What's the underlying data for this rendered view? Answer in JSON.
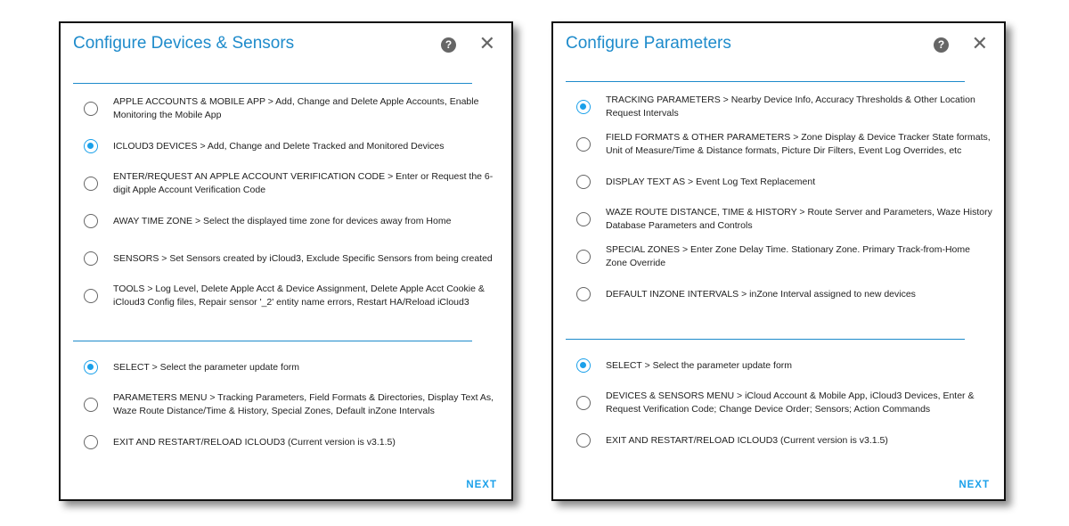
{
  "dialogs": [
    {
      "title": "Configure Devices & Sensors",
      "group1": [
        {
          "label": "APPLE ACCOUNTS & MOBILE APP > Add, Change and Delete Apple Accounts, Enable Monitoring the Mobile App",
          "selected": false
        },
        {
          "label": "ICLOUD3 DEVICES > Add, Change and Delete Tracked and Monitored Devices",
          "selected": true
        },
        {
          "label": "ENTER/REQUEST AN APPLE ACCOUNT VERIFICATION CODE > Enter or Request the 6-digit Apple Account Verification Code",
          "selected": false
        },
        {
          "label": "AWAY TIME ZONE > Select the displayed time zone for devices away from Home",
          "selected": false
        },
        {
          "label": "SENSORS > Set Sensors created by iCloud3, Exclude Specific Sensors from being created",
          "selected": false
        },
        {
          "label": "TOOLS > Log Level, Delete Apple Acct & Device Assignment, Delete Apple Acct Cookie & iCloud3 Config files, Repair sensor '_2' entity name errors, Restart HA/Reload iCloud3",
          "selected": false
        }
      ],
      "group2": [
        {
          "label": "SELECT > Select the parameter update form",
          "selected": true
        },
        {
          "label": "PARAMETERS MENU > Tracking Parameters, Field Formats & Directories, Display Text As, Waze Route Distance/Time & History, Special Zones, Default inZone Intervals",
          "selected": false
        },
        {
          "label": "EXIT AND RESTART/RELOAD ICLOUD3 (Current version is v3.1.5)",
          "selected": false
        }
      ],
      "next_label": "NEXT"
    },
    {
      "title": "Configure Parameters",
      "group1": [
        {
          "label": "TRACKING PARAMETERS > Nearby Device Info, Accuracy Thresholds & Other Location Request Intervals",
          "selected": true
        },
        {
          "label": "FIELD FORMATS & OTHER PARAMETERS > Zone Display & Device Tracker State formats, Unit of Measure/Time & Distance formats, Picture Dir Filters, Event Log Overrides, etc",
          "selected": false
        },
        {
          "label": "DISPLAY TEXT AS > Event Log Text Replacement",
          "selected": false
        },
        {
          "label": "WAZE ROUTE DISTANCE, TIME & HISTORY > Route Server and Parameters, Waze History Database Parameters and Controls",
          "selected": false
        },
        {
          "label": "SPECIAL ZONES > Enter Zone Delay Time. Stationary Zone. Primary Track-from-Home Zone Override",
          "selected": false
        },
        {
          "label": "DEFAULT INZONE INTERVALS > inZone Interval assigned to new devices",
          "selected": false
        }
      ],
      "group2": [
        {
          "label": "SELECT > Select the parameter update form",
          "selected": true
        },
        {
          "label": "DEVICES & SENSORS MENU > iCloud Account & Mobile App, iCloud3 Devices, Enter & Request Verification Code; Change Device Order; Sensors; Action Commands",
          "selected": false
        },
        {
          "label": "EXIT AND RESTART/RELOAD ICLOUD3 (Current version is v3.1.5)",
          "selected": false
        }
      ],
      "next_label": "NEXT"
    }
  ],
  "icons": {
    "help": "help-circle-icon",
    "close": "close-icon"
  },
  "colors": {
    "accent": "#1aa0ea",
    "title": "#1e8bcb"
  }
}
